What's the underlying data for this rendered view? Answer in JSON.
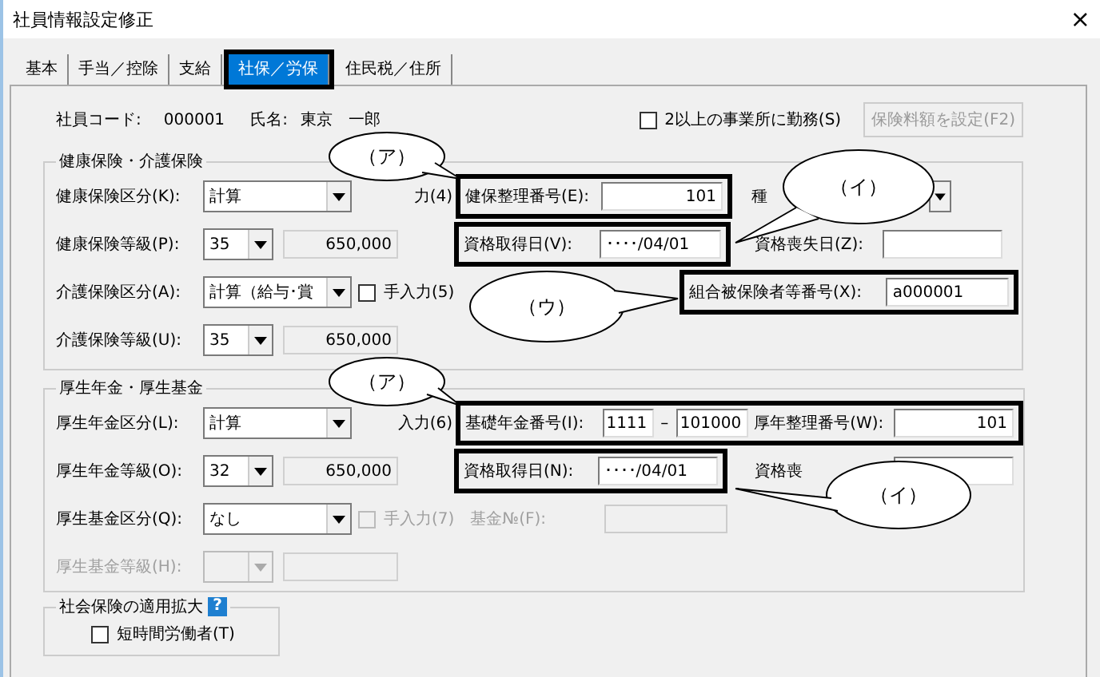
{
  "window": {
    "title": "社員情報設定修正",
    "close": "×"
  },
  "tabs": [
    {
      "label": "基本",
      "selected": false,
      "outlined": false
    },
    {
      "label": "手当／控除",
      "selected": false,
      "outlined": false
    },
    {
      "label": "支給",
      "selected": false,
      "outlined": false
    },
    {
      "label": "社保／労保",
      "selected": true,
      "outlined": true
    },
    {
      "label": "住民税／住所",
      "selected": false,
      "outlined": false
    }
  ],
  "employee": {
    "code_label": "社員コード:",
    "code": "000001",
    "name_label": "氏名:",
    "name": "東京　一郎"
  },
  "multi_office": {
    "label": "2以上の事業所に勤務(S)",
    "checked": false
  },
  "premium_button": {
    "label": "保険料額を設定(F2)",
    "disabled": true
  },
  "health": {
    "title": "健康保険・介護保険",
    "kubun": {
      "label": "健康保険区分(K):",
      "value": "計算"
    },
    "manual_partial": "力(4)",
    "seiri": {
      "label": "健保整理番号(E):",
      "value": "101",
      "outlined": true
    },
    "kind_partial": "種",
    "grade": {
      "label": "健康保険等級(P):",
      "value": "35",
      "amount": "650,000"
    },
    "acquired": {
      "label": "資格取得日(V):",
      "value": "････/04/01",
      "outlined": true
    },
    "lost": {
      "label": "資格喪失日(Z):"
    },
    "kaigo_kubun": {
      "label": "介護保険区分(A):",
      "value": "計算（給与･賞"
    },
    "kaigo_manual": {
      "label": "手入力(5)",
      "checked": false
    },
    "union_no": {
      "label": "組合被保険者等番号(X):",
      "value": "a000001",
      "outlined": true
    },
    "kaigo_grade": {
      "label": "介護保険等級(U):",
      "value": "35",
      "amount": "650,000"
    }
  },
  "pension": {
    "title": "厚生年金・厚生基金",
    "kubun": {
      "label": "厚生年金区分(L):",
      "value": "計算"
    },
    "manual_partial": "入力(6)",
    "basic_no": {
      "label": "基礎年金番号(I):",
      "part1": "1111",
      "separator": "–",
      "part2": "101000",
      "outlined": true
    },
    "seiri": {
      "label": "厚年整理番号(W):",
      "value": "101"
    },
    "grade": {
      "label": "厚生年金等級(O):",
      "value": "32",
      "amount": "650,000"
    },
    "acquired": {
      "label": "資格取得日(N):",
      "value": "････/04/01",
      "outlined": true
    },
    "lost_partial": "資格喪",
    "fund_kubun": {
      "label": "厚生基金区分(Q):",
      "value": "なし"
    },
    "fund_manual": {
      "label": "手入力(7)",
      "checked": false,
      "disabled": true
    },
    "fund_no": {
      "label": "基金№(F):",
      "disabled": true
    },
    "fund_grade": {
      "label": "厚生基金等級(H):",
      "disabled": true
    }
  },
  "expansion": {
    "title": "社会保険の適用拡大",
    "help": "?",
    "part_time": {
      "label": "短時間労働者(T)",
      "checked": false
    }
  },
  "callouts": [
    {
      "label": "（ア）"
    },
    {
      "label": "（イ）"
    },
    {
      "label": "（ウ）"
    },
    {
      "label": "（ア）"
    },
    {
      "label": "（イ）"
    }
  ]
}
